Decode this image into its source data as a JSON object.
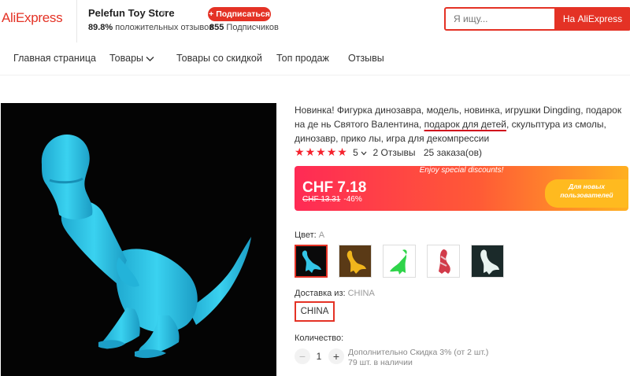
{
  "header": {
    "logo": "AliExpress",
    "store_name": "Pelefun Toy Store",
    "positive_pct": "89.8%",
    "positive_label": "положительных отзывов",
    "subscribe_label": "+ Подписаться",
    "subscribers_count": "855",
    "subscribers_label": "Подписчиков",
    "search_placeholder": "Я ищу...",
    "search_button": "На AliExpress"
  },
  "nav": {
    "items": [
      {
        "label": "Главная страница"
      },
      {
        "label": "Товары"
      },
      {
        "label": "Товары со скидкой"
      },
      {
        "label": "Топ продаж"
      },
      {
        "label": "Отзывы"
      }
    ]
  },
  "product": {
    "title_part1": "Новинка! Фигурка динозавра, модель, новинка, игрушки Dingding, подарок на де нь Святого Валентина, ",
    "title_underlined": "подарок для детей",
    "title_part2": ", скульптура из смолы, динозавр, прико лы, игра для декомпрессии",
    "rating_value": "5",
    "reviews": "2 Отзывы",
    "orders": "25 заказа(ов)",
    "enjoy_text": "Enjoy special discounts!",
    "price": "CHF 7.18",
    "old_price": "CHF 13.31",
    "discount": "-46%",
    "promo_text": "Для новых пользователей",
    "color_label": "Цвет:",
    "color_value": "A",
    "ship_from_label": "Доставка из:",
    "ship_from_value": "CHINA",
    "ship_option": "CHINA",
    "qty_label": "Количество:",
    "qty_minus": "−",
    "qty_value": "1",
    "qty_plus": "+",
    "extra_discount": "Дополнительно Скидка 3% (от 2 шт.)",
    "stock": "79 шт. в наличии"
  },
  "colors": {
    "accent": "#e43225",
    "figure_blue": "#2ec8e8",
    "star": "#f5222d"
  }
}
